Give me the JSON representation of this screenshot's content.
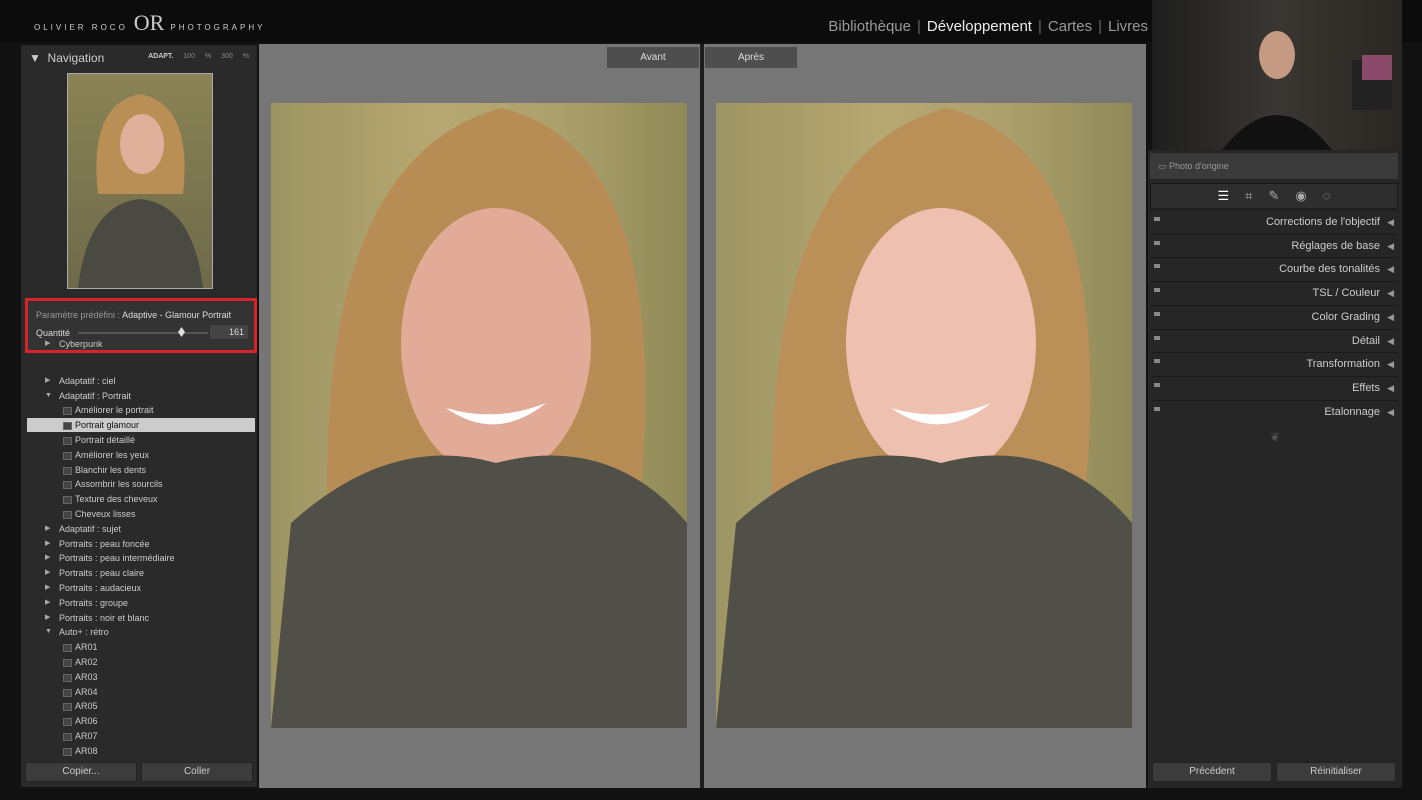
{
  "top": {
    "logo": {
      "left": "OLIVIER ROCO",
      "mark": "OR",
      "right": "PHOTOGRAPHY"
    },
    "modules": [
      "Bibliothèque",
      "Développement",
      "Cartes",
      "Livres"
    ],
    "active": "Développement"
  },
  "navigator": {
    "title": "Navigation",
    "zoom_options": [
      "ADAPT.",
      "100 %",
      "300 %"
    ]
  },
  "preset": {
    "label": "Paramètre prédéfini :",
    "name": "Adaptive - Glamour Portrait",
    "amount_label": "Quantité",
    "amount": "161",
    "amount_value": 161
  },
  "preset_list": [
    {
      "label": "Cyberpunk",
      "type": "group"
    },
    {
      "label": "Adaptatif : ciel",
      "type": "group"
    },
    {
      "label": "Adaptatif : Portrait",
      "type": "group",
      "open": true
    },
    {
      "label": "Améliorer le portrait",
      "type": "child"
    },
    {
      "label": "Portrait glamour",
      "type": "child",
      "selected": true
    },
    {
      "label": "Portrait détaillé",
      "type": "child"
    },
    {
      "label": "Améliorer les yeux",
      "type": "child"
    },
    {
      "label": "Blanchir les dents",
      "type": "child"
    },
    {
      "label": "Assombrir les sourcils",
      "type": "child"
    },
    {
      "label": "Texture des cheveux",
      "type": "child"
    },
    {
      "label": "Cheveux lisses",
      "type": "child"
    },
    {
      "label": "Adaptatif : sujet",
      "type": "group"
    },
    {
      "label": "Portraits : peau foncée",
      "type": "group"
    },
    {
      "label": "Portraits : peau intermédiaire",
      "type": "group"
    },
    {
      "label": "Portraits : peau claire",
      "type": "group"
    },
    {
      "label": "Portraits : audacieux",
      "type": "group"
    },
    {
      "label": "Portraits : groupe",
      "type": "group"
    },
    {
      "label": "Portraits : noir et blanc",
      "type": "group"
    },
    {
      "label": "Auto+ : rétro",
      "type": "group",
      "open": true
    },
    {
      "label": "AR01",
      "type": "child"
    },
    {
      "label": "AR02",
      "type": "child"
    },
    {
      "label": "AR03",
      "type": "child"
    },
    {
      "label": "AR04",
      "type": "child"
    },
    {
      "label": "AR05",
      "type": "child"
    },
    {
      "label": "AR06",
      "type": "child"
    },
    {
      "label": "AR07",
      "type": "child"
    },
    {
      "label": "AR08",
      "type": "child"
    }
  ],
  "left_buttons": {
    "copy": "Copier...",
    "paste": "Coller"
  },
  "view": {
    "before": "Avant",
    "after": "Après"
  },
  "right": {
    "original_photo": "Photo d'origine",
    "tools": [
      "sliders-icon",
      "crop-icon",
      "heal-icon",
      "redeye-icon",
      "mask-icon"
    ],
    "sections": [
      "Corrections de l'objectif",
      "Réglages de base",
      "Courbe des tonalités",
      "TSL / Couleur",
      "Color Grading",
      "Détail",
      "Transformation",
      "Effets",
      "Etalonnage"
    ],
    "previous": "Précédent",
    "reset": "Réinitialiser"
  },
  "colors": {
    "highlight": "#d8232a"
  }
}
